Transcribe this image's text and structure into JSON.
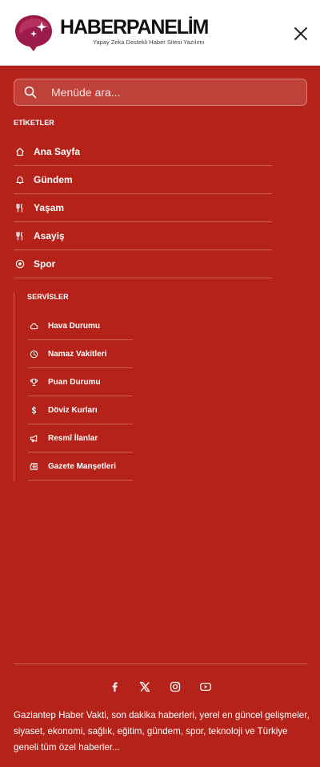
{
  "brand": {
    "name": "HABERPANELİM",
    "tagline": "Yapay Zeka Destekli Haber Sitesi Yazılımı",
    "logo_color": "#9b1c4a"
  },
  "search": {
    "placeholder": "Menüde ara..."
  },
  "tags_section": {
    "title": "ETİKETLER",
    "items": [
      {
        "label": "Ana Sayfa",
        "icon": "home-icon"
      },
      {
        "label": "Gündem",
        "icon": "bell-icon"
      },
      {
        "label": "Yaşam",
        "icon": "utensils-icon"
      },
      {
        "label": "Asayiş",
        "icon": "utensils-icon"
      },
      {
        "label": "Spor",
        "icon": "ball-icon"
      }
    ]
  },
  "services_section": {
    "title": "SERVİSLER",
    "items": [
      {
        "label": "Hava Durumu",
        "icon": "cloud-icon"
      },
      {
        "label": "Namaz Vakitleri",
        "icon": "clock-icon"
      },
      {
        "label": "Puan Durumu",
        "icon": "trophy-icon"
      },
      {
        "label": "Döviz Kurları",
        "icon": "dollar-icon"
      },
      {
        "label": "Resmî İlanlar",
        "icon": "megaphone-icon"
      },
      {
        "label": "Gazete Manşetleri",
        "icon": "newspaper-icon"
      }
    ]
  },
  "footer": {
    "socials": [
      "facebook-icon",
      "x-icon",
      "instagram-icon",
      "youtube-icon"
    ],
    "description": "Gaziantep Haber Vakti, son dakika haberleri, yerel en güncel gelişmeler, siyaset, ekonomi, sağlık, eğitim, gündem, spor, teknoloji ve Türkiye geneli tüm özel haberler..."
  },
  "colors": {
    "background": "#b52219",
    "text": "#ffffff",
    "header_bg": "#ffffff"
  }
}
